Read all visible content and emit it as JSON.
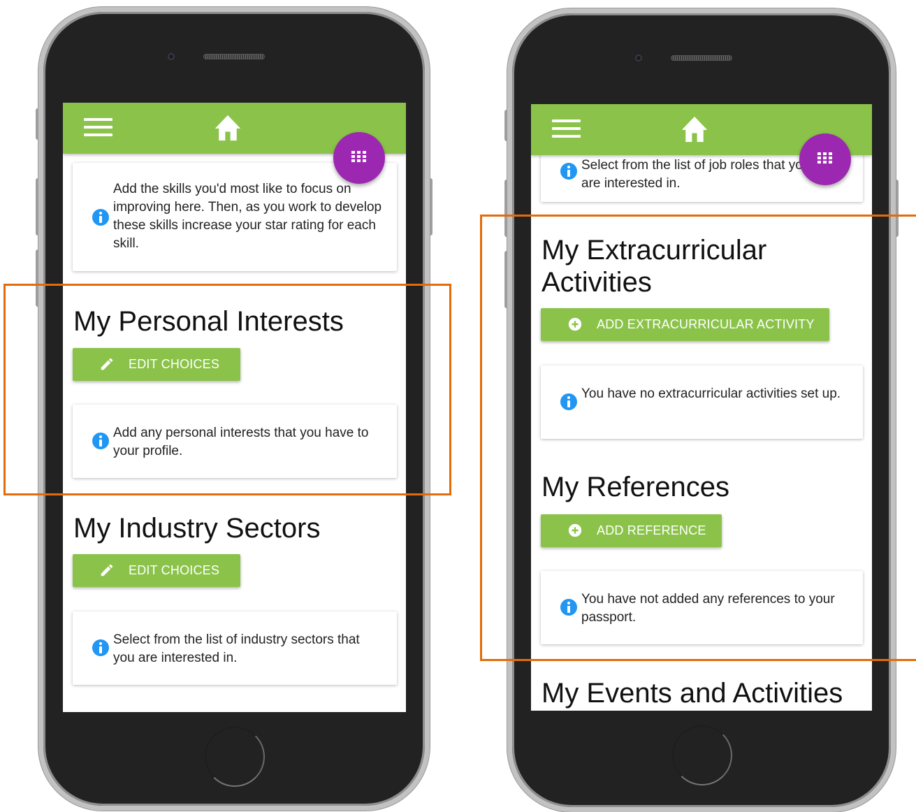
{
  "colors": {
    "appbar": "#8bc34a",
    "button": "#8bc34a",
    "fab": "#9c27b0",
    "info_icon": "#2196f3",
    "highlight": "#e36c09",
    "phone_body": "#222222"
  },
  "icons": {
    "menu": "hamburger-menu-icon",
    "home": "home-icon",
    "apps": "apps-grid-icon",
    "edit": "pencil-icon",
    "add": "plus-circle-icon",
    "info": "info-circle-icon"
  },
  "left_phone": {
    "top_card_text": "Add the skills you'd most like to focus on improving here. Then, as you work to develop these skills increase your star rating for each skill.",
    "personal_interests": {
      "title": "My Personal Interests",
      "button_label": "EDIT CHOICES",
      "info_text": "Add any personal interests that you have to your profile."
    },
    "industry_sectors": {
      "title": "My Industry Sectors",
      "button_label": "EDIT CHOICES",
      "info_text": "Select from the list of industry sectors that you are interested in."
    }
  },
  "right_phone": {
    "top_card_text": "Select from the list of job roles that you are interested in.",
    "extracurricular": {
      "title_line1": "My Extracurricular",
      "title_line2": "Activities",
      "button_label": "ADD EXTRACURRICULAR ACTIVITY",
      "info_text": "You have no extracurricular activities set up."
    },
    "references": {
      "title": "My References",
      "button_label": "ADD REFERENCE",
      "info_text": "You have not added any references to your passport."
    },
    "events": {
      "title": "My Events and Activities"
    }
  }
}
